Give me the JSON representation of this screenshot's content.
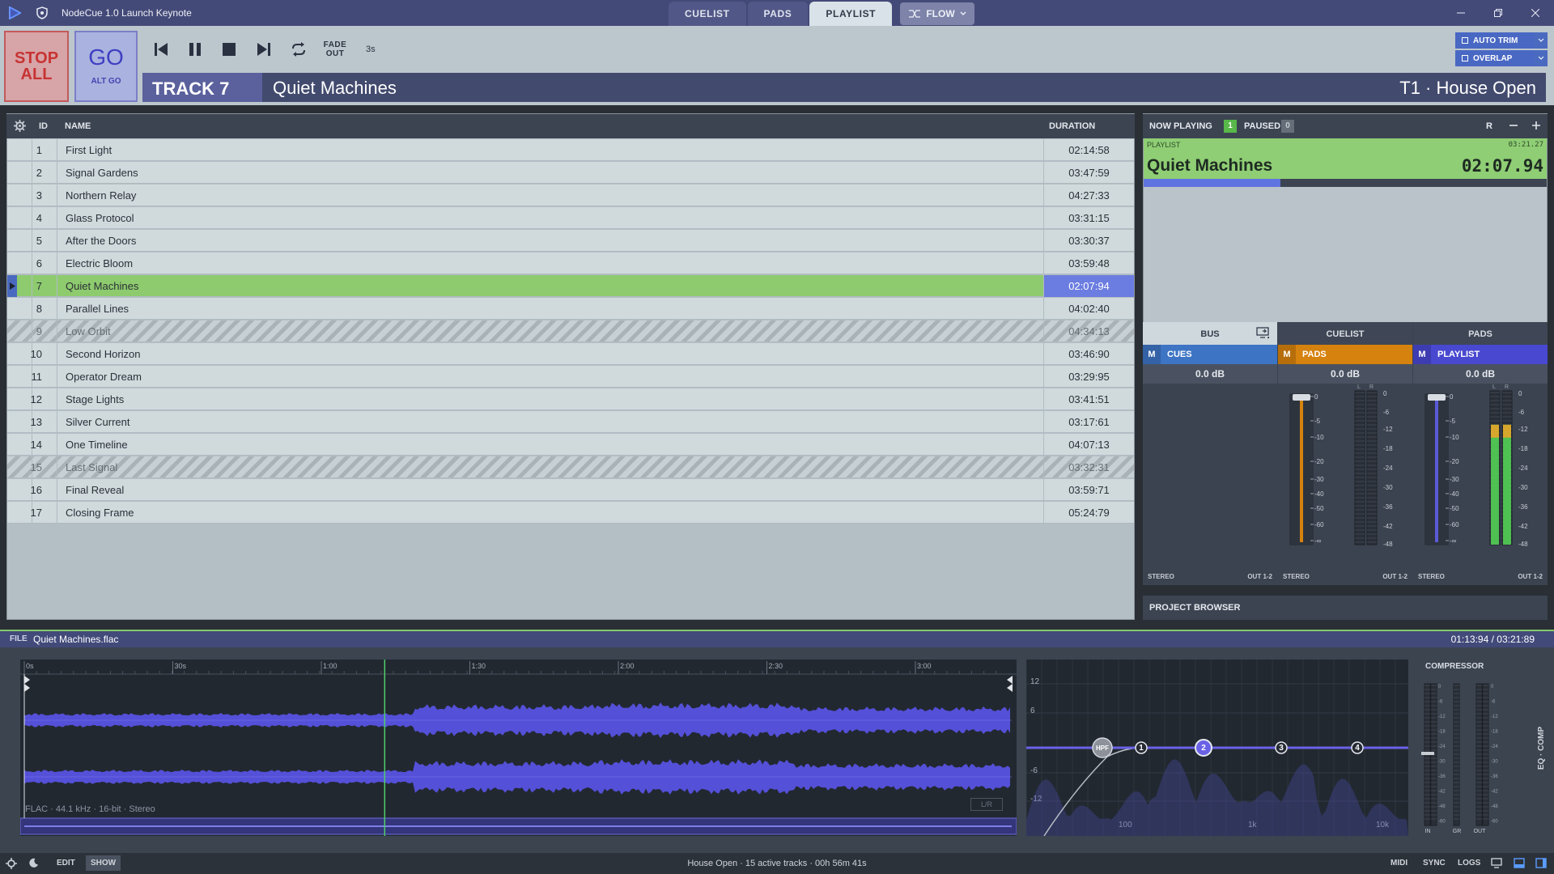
{
  "window": {
    "title": "NodeCue 1.0 Launch Keynote",
    "tabs": [
      "CUELIST",
      "PADS",
      "PLAYLIST"
    ],
    "active_tab": "PLAYLIST",
    "flow_label": "FLOW"
  },
  "transport": {
    "stop_all": "STOP ALL",
    "go": "GO",
    "alt_go": "ALT GO",
    "fade_out": "FADE OUT",
    "fade_time": "3s",
    "auto_trim": "AUTO TRIM",
    "overlap": "OVERLAP",
    "track_id": "TRACK 7",
    "track_name": "Quiet Machines",
    "cue_label": "T1 · House Open"
  },
  "playlist": {
    "columns": {
      "id": "ID",
      "name": "NAME",
      "duration": "DURATION"
    },
    "rows": [
      {
        "id": "1",
        "name": "First Light",
        "duration": "02:14:58",
        "state": "normal"
      },
      {
        "id": "2",
        "name": "Signal Gardens",
        "duration": "03:47:59",
        "state": "normal"
      },
      {
        "id": "3",
        "name": "Northern Relay",
        "duration": "04:27:33",
        "state": "normal"
      },
      {
        "id": "4",
        "name": "Glass Protocol",
        "duration": "03:31:15",
        "state": "normal"
      },
      {
        "id": "5",
        "name": "After the Doors",
        "duration": "03:30:37",
        "state": "normal"
      },
      {
        "id": "6",
        "name": "Electric Bloom",
        "duration": "03:59:48",
        "state": "normal"
      },
      {
        "id": "7",
        "name": "Quiet Machines",
        "duration": "02:07:94",
        "state": "active"
      },
      {
        "id": "8",
        "name": "Parallel Lines",
        "duration": "04:02:40",
        "state": "normal"
      },
      {
        "id": "9",
        "name": "Low Orbit",
        "duration": "04:34:13",
        "state": "disabled"
      },
      {
        "id": "10",
        "name": "Second Horizon",
        "duration": "03:46:90",
        "state": "normal"
      },
      {
        "id": "11",
        "name": "Operator Dream",
        "duration": "03:29:95",
        "state": "normal"
      },
      {
        "id": "12",
        "name": "Stage Lights",
        "duration": "03:41:51",
        "state": "normal"
      },
      {
        "id": "13",
        "name": "Silver Current",
        "duration": "03:17:61",
        "state": "normal"
      },
      {
        "id": "14",
        "name": "One Timeline",
        "duration": "04:07:13",
        "state": "normal"
      },
      {
        "id": "15",
        "name": "Last Signal",
        "duration": "03:32:31",
        "state": "disabled"
      },
      {
        "id": "16",
        "name": "Final Reveal",
        "duration": "03:59:71",
        "state": "normal"
      },
      {
        "id": "17",
        "name": "Closing Frame",
        "duration": "05:24:79",
        "state": "normal"
      }
    ]
  },
  "now_playing": {
    "label": "NOW PLAYING",
    "playing_count": "1",
    "paused_label": "PAUSED",
    "paused_count": "0",
    "r_label": "R",
    "source": "PLAYLIST",
    "total": "03:21.27",
    "name": "Quiet Machines",
    "remaining": "02:07.94",
    "progress": 0.34
  },
  "mixer": {
    "columns": [
      {
        "header": "BUS",
        "bus": "CUES",
        "color": "#3d74c4",
        "db": "0.0 dB",
        "fader": "#4a88d0",
        "meter": [
          0,
          0
        ]
      },
      {
        "header": "CUELIST",
        "bus": "PADS",
        "color": "#d6820e",
        "db": "0.0 dB",
        "fader": "#d6820e",
        "meter": [
          0,
          0
        ]
      },
      {
        "header": "PADS",
        "bus": "PLAYLIST",
        "color": "#4848d0",
        "db": "0.0 dB",
        "fader": "#5a5ad8",
        "meter": [
          0.78,
          0.78
        ]
      }
    ],
    "fader_scale": [
      "0",
      "-5",
      "-10",
      "-20",
      "-30",
      "-40",
      "-50",
      "-60",
      "-∞"
    ],
    "meter_scale": [
      "0",
      "-6",
      "-12",
      "-18",
      "-24",
      "-30",
      "-36",
      "-42",
      "-48"
    ],
    "meter_lr": [
      "L",
      "R"
    ],
    "stereo": "STEREO",
    "out": "OUT 1-2",
    "mute": "M"
  },
  "project_browser": "PROJECT BROWSER",
  "file": {
    "label": "FILE",
    "name": "Quiet Machines.flac",
    "time": "01:13:94 / 03:21:89",
    "format": "FLAC · 44.1 kHz · 16-bit · Stereo",
    "ruler": [
      "0s",
      "30s",
      "1:00",
      "1:30",
      "2:00",
      "2:30",
      "3:00"
    ],
    "playhead": 0.365,
    "channel_tag": "L/R"
  },
  "eq": {
    "y_labels": [
      "12",
      "6",
      "-6",
      "-12"
    ],
    "x_labels": [
      "100",
      "1k",
      "10k"
    ],
    "nodes": [
      "HPF",
      "1",
      "2",
      "3",
      "4"
    ]
  },
  "compressor": {
    "label": "COMPRESSOR",
    "side_label": "EQ · COMP",
    "in": "IN",
    "gr": "GR",
    "out": "OUT"
  },
  "status": {
    "edit": "EDIT",
    "show": "SHOW",
    "text": "House Open · 15 active tracks · 00h 56m 41s",
    "midi": "MIDI",
    "sync": "SYNC",
    "logs": "LOGS"
  }
}
